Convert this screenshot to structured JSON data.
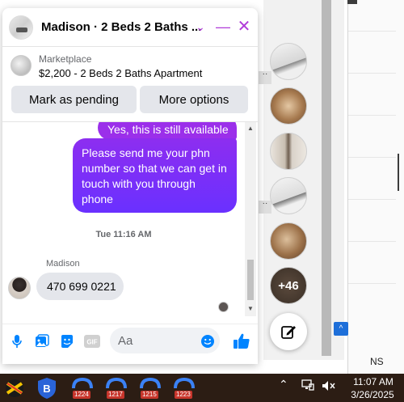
{
  "chat": {
    "title": "Madison · 2 Beds 2 Baths ...",
    "marketplace_label": "Marketplace",
    "listing": "$2,200 - 2 Beds 2 Baths Apartment",
    "mark_pending_label": "Mark as pending",
    "more_options_label": "More options",
    "messages": [
      {
        "from": "me",
        "text": "Yes, this is still available"
      },
      {
        "from": "me",
        "text": "Please send me your phn number so that we can get in touch with you through phone"
      },
      {
        "from": "Madison",
        "text": "470 699 0221"
      }
    ],
    "timestamp": "Tue 11:16 AM",
    "sender_name": "Madison",
    "input_placeholder": "Aa"
  },
  "chat_heads": {
    "more_count": "+46"
  },
  "background_window": {
    "partial_text": "NS"
  },
  "taskbar": {
    "badges": [
      "1224",
      "1217",
      "1215",
      "1223"
    ],
    "time": "11:07 AM",
    "date": "3/26/2025"
  },
  "colors": {
    "messenger_purple": "#a033e9",
    "messenger_blue": "#0084ff",
    "taskbar_bg": "#2c1d14"
  }
}
